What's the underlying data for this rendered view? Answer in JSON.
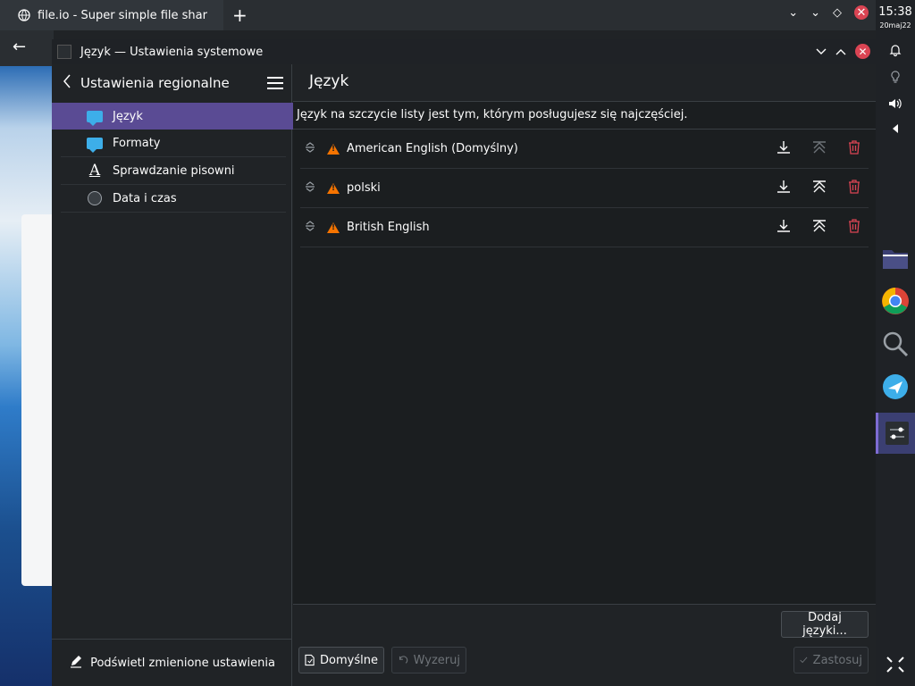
{
  "browser": {
    "tab_title": "file.io - Super simple file sharing",
    "new_tab_symbol": "+"
  },
  "panel": {
    "time": "15:38",
    "date": "20maj22"
  },
  "window": {
    "title": "Język — Ustawienia systemowe"
  },
  "sidebar": {
    "title": "Ustawienia regionalne",
    "items": [
      {
        "label": "Język",
        "icon": "chat-bubble-icon"
      },
      {
        "label": "Formaty",
        "icon": "chat-bubble-icon"
      },
      {
        "label": "Sprawdzanie pisowni",
        "icon": "spellcheck-icon"
      },
      {
        "label": "Data i czas",
        "icon": "clock-icon"
      }
    ],
    "footer_label": "Podświetl zmienione ustawienia"
  },
  "content": {
    "title": "Język",
    "info": "Język na szczycie listy jest tym, którym posługujesz się najczęściej.",
    "languages": [
      {
        "name": "American English (Domyślny)"
      },
      {
        "name": "polski"
      },
      {
        "name": "British English"
      }
    ],
    "add_button": "Dodaj języki...",
    "defaults_button": "Domyślne",
    "reset_button": "Wyzeruj",
    "apply_button": "Zastosuj"
  },
  "colors": {
    "accent": "#5a4b94",
    "warning": "#f67400",
    "danger": "#da4453",
    "info_blue": "#3daee9"
  }
}
